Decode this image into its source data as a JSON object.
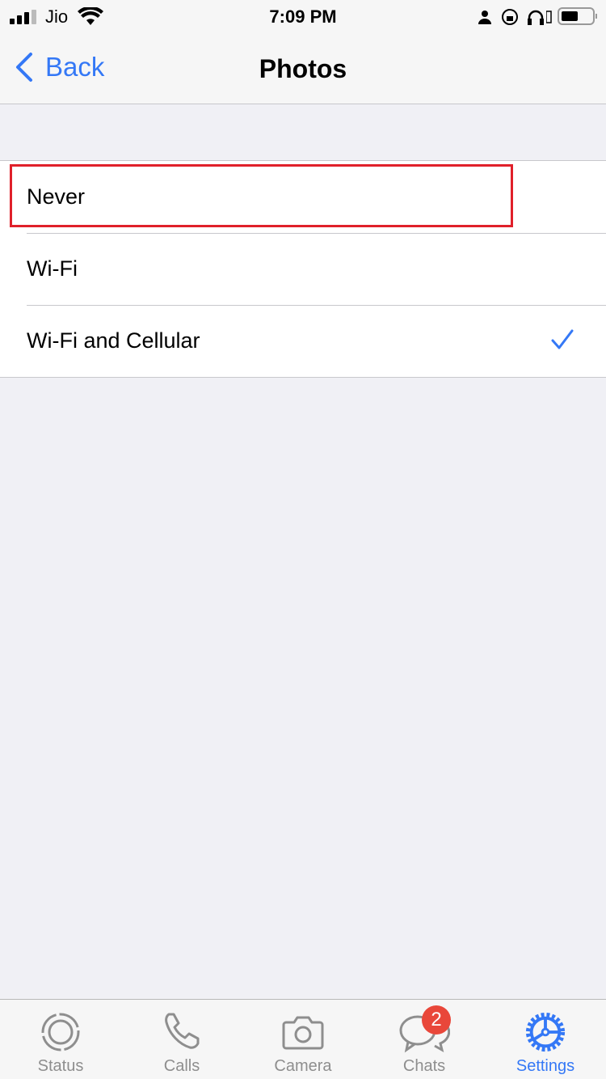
{
  "status_bar": {
    "carrier": "Jio",
    "time": "7:09 PM"
  },
  "nav": {
    "back_label": "Back",
    "title": "Photos"
  },
  "options": [
    {
      "label": "Never",
      "selected": false
    },
    {
      "label": "Wi-Fi",
      "selected": false
    },
    {
      "label": "Wi-Fi and Cellular",
      "selected": true
    }
  ],
  "tabs": [
    {
      "label": "Status",
      "icon": "status-icon"
    },
    {
      "label": "Calls",
      "icon": "phone-icon"
    },
    {
      "label": "Camera",
      "icon": "camera-icon"
    },
    {
      "label": "Chats",
      "icon": "chat-icon",
      "badge": "2"
    },
    {
      "label": "Settings",
      "icon": "gear-icon",
      "active": true
    }
  ],
  "colors": {
    "accent": "#3478f6",
    "badge": "#e9473a",
    "highlight": "#e0202a"
  }
}
